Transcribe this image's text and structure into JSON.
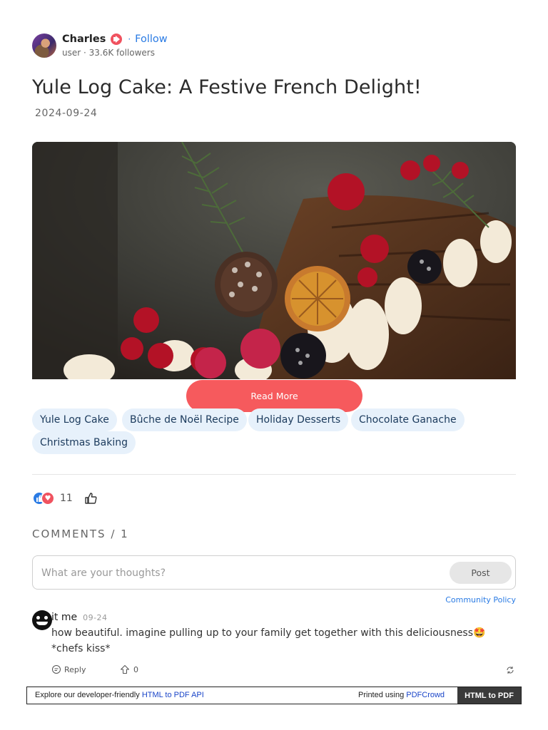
{
  "author": {
    "name": "Charles",
    "separator": "·",
    "follow_label": "Follow",
    "meta": "user · 33.6K followers",
    "badge_icon": "megaphone-icon"
  },
  "article": {
    "title": "Yule Log Cake: A Festive French Delight!",
    "date": "2024-09-24",
    "read_more_label": "Read More",
    "tags": [
      "Yule Log Cake",
      "Bûche de Noël Recipe",
      "Holiday Desserts",
      "Chocolate Ganache",
      "Christmas Baking"
    ]
  },
  "reactions": {
    "count": "11",
    "icons": [
      "like-icon",
      "heart-icon",
      "thumbs-up-icon"
    ]
  },
  "comments": {
    "heading": "COMMENTS / 1",
    "input_placeholder": "What are your thoughts?",
    "post_label": "Post",
    "policy_label": "Community Policy",
    "items": [
      {
        "user": "it me",
        "date": "09-24",
        "text": "how beautiful. imagine pulling up to your family get together with this deliciousness🤩*chefs kiss*",
        "reply_label": "Reply",
        "votes": "0"
      }
    ]
  },
  "banner": {
    "left_text": "Explore our developer-friendly ",
    "left_link": "HTML to PDF API",
    "mid_text": "Printed using ",
    "mid_link": "PDFCrowd",
    "button_label": "HTML to PDF"
  },
  "colors": {
    "accent_blue": "#2a7be4",
    "read_more": "#f65a5d",
    "tag_bg": "#e7f1fb"
  }
}
